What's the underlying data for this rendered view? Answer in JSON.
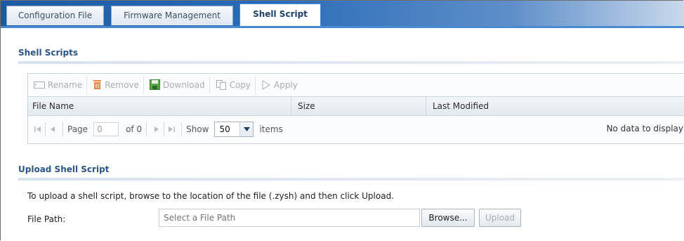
{
  "tabs": [
    {
      "label": "Configuration File",
      "active": false
    },
    {
      "label": "Firmware Management",
      "active": false
    },
    {
      "label": "Shell Script",
      "active": true
    }
  ],
  "shell_scripts": {
    "title": "Shell Scripts",
    "toolbar": {
      "rename": "Rename",
      "remove": "Remove",
      "download": "Download",
      "copy": "Copy",
      "apply": "Apply"
    },
    "columns": [
      "File Name",
      "Size",
      "Last Modified"
    ],
    "pager": {
      "page_label": "Page",
      "page_value": "0",
      "of_label": "of 0",
      "show_label": "Show",
      "show_value": "50",
      "items_label": "items",
      "no_data": "No data to display"
    }
  },
  "upload": {
    "title": "Upload Shell Script",
    "instructions": "To upload a shell script, browse to the location of the file (.zysh) and then click Upload.",
    "file_path_label": "File Path:",
    "file_path_placeholder": "Select a File Path",
    "browse_label": "Browse...",
    "upload_label": "Upload"
  },
  "colors": {
    "tab_bar": "#2a6cb8",
    "section_title": "#2c5487",
    "disabled_text": "#a7adb5",
    "remove_icon": "#e8894a",
    "download_icon": "#5aa84a"
  },
  "icons": {
    "rename": "rename-icon",
    "remove": "trash-icon",
    "download": "download-icon",
    "copy": "copy-icon",
    "apply": "apply-arrow-icon"
  }
}
